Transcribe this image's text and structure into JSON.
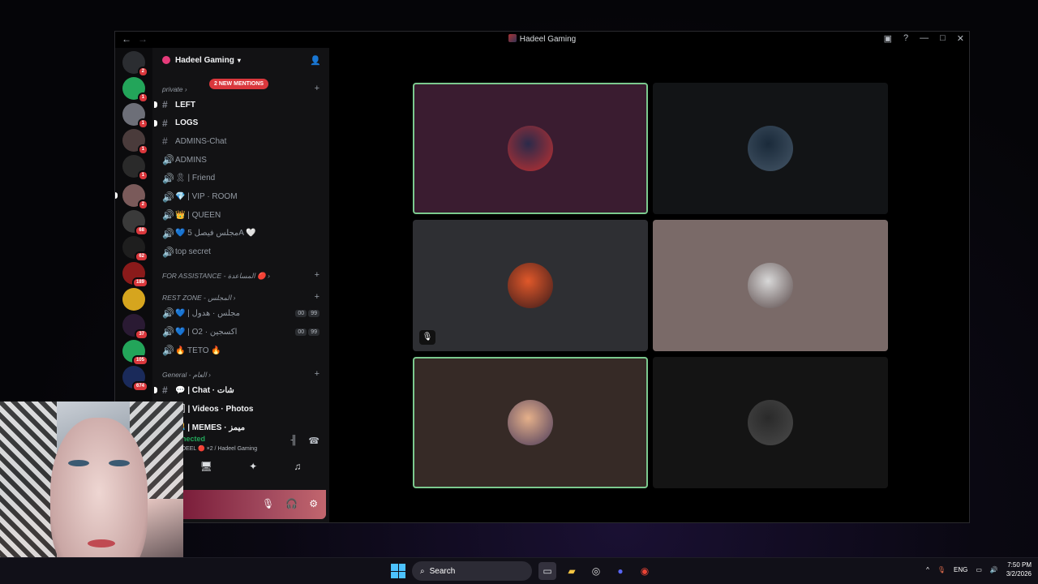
{
  "window": {
    "title": "Hadeel Gaming",
    "back_icon": "arrow-left-icon",
    "forward_icon": "arrow-right-icon"
  },
  "server_rail": {
    "items": [
      {
        "name": "direct-messages",
        "badge": "2",
        "color": "#2b2d31"
      },
      {
        "name": "server-1",
        "badge": "1",
        "color": "#23a55a"
      },
      {
        "name": "server-2",
        "badge": "1",
        "color": "#6d6f78"
      },
      {
        "name": "server-3",
        "badge": "1",
        "color": "#4a3b3b"
      },
      {
        "name": "server-4",
        "badge": "1",
        "color": "#2a2a2a"
      },
      {
        "name": "server-hadeel",
        "badge": "2",
        "color": "#7a5a5a"
      },
      {
        "name": "server-6",
        "badge": "68",
        "color": "#3a3a3a"
      },
      {
        "name": "server-7",
        "badge": "62",
        "color": "#1e1e1e"
      },
      {
        "name": "server-8",
        "badge": "189",
        "color": "#8a1a1a"
      },
      {
        "name": "server-emperor",
        "badge": "",
        "color": "#d6a51e"
      },
      {
        "name": "server-10",
        "badge": "37",
        "color": "#2a1a33"
      },
      {
        "name": "server-11",
        "badge": "105",
        "color": "#23a55a"
      },
      {
        "name": "server-12",
        "badge": "674",
        "color": "#1a2a5a"
      }
    ]
  },
  "channel_sidebar": {
    "server_name": "Hadeel Gaming",
    "mentions_badge": "2 NEW MENTIONS",
    "categories": [
      {
        "label": "private",
        "top": 0
      },
      {
        "label": "FOR ASSISTANCE - المساعدة",
        "top": 0
      },
      {
        "label": "REST ZONE - المجلس",
        "top": 0
      },
      {
        "label": "General - العام",
        "top": 0
      }
    ],
    "channels_private": [
      {
        "label": "LEFT",
        "type": "text",
        "bright": true
      },
      {
        "label": "LOGS",
        "type": "text",
        "bright": true
      },
      {
        "label": "ADMINS-Chat",
        "type": "text",
        "bright": false
      },
      {
        "label": "ADMINS",
        "type": "voice",
        "bright": false
      },
      {
        "label": "🎗 | Friend",
        "type": "voice",
        "bright": false
      },
      {
        "label": "💎 | VIP · ROOM",
        "type": "voice",
        "bright": false
      },
      {
        "label": "👑 | QUEEN",
        "type": "voice",
        "bright": false
      },
      {
        "label": "💙 مجلس فيصل 5A 🤍",
        "type": "voice",
        "bright": false
      },
      {
        "label": "top secret",
        "type": "voice",
        "bright": false
      }
    ],
    "channels_rest": [
      {
        "label": "💙 | مجلس · هدول",
        "meta": [
          "00",
          "99"
        ]
      },
      {
        "label": "💙 | O2 · اكسجين",
        "meta": [
          "00",
          "99"
        ]
      },
      {
        "label": "🔥 TETO 🔥",
        "meta": []
      }
    ],
    "channels_general": [
      {
        "label": "💬 | Chat · شات",
        "bright": true
      },
      {
        "label": "🖼 | Videos · Photos",
        "bright": true
      },
      {
        "label": "😹 | MEMES · ميمز",
        "bright": true
      }
    ]
  },
  "voice_panel": {
    "status": "Voice Connected",
    "status_visible": "nected",
    "subtext": "DEEL 🔴 ×2 / Hadeel Gaming"
  },
  "stage": {
    "tiles": [
      {
        "name": "tile-participant-1",
        "bg": "#3a1c30",
        "speaking": true,
        "avatar": [
          "#2a2a4a",
          "#c23030"
        ]
      },
      {
        "name": "tile-participant-2",
        "bg": "#121416",
        "speaking": false,
        "avatar": [
          "#1a2a3a",
          "#445566"
        ]
      },
      {
        "name": "tile-participant-3",
        "bg": "#2e2f33",
        "speaking": false,
        "avatar": [
          "#e0582a",
          "#3a1a1a"
        ],
        "muted": true
      },
      {
        "name": "tile-participant-4",
        "bg": "#7a6a68",
        "speaking": false,
        "avatar": [
          "#d8d8d8",
          "#5a4a4a"
        ]
      },
      {
        "name": "tile-participant-5",
        "bg": "#362a26",
        "speaking": true,
        "avatar": [
          "#e5b08a",
          "#4a3a5a"
        ]
      },
      {
        "name": "tile-participant-6",
        "bg": "#141414",
        "speaking": false,
        "avatar": [
          "#2a2a2a",
          "#4a4a4a"
        ]
      }
    ]
  },
  "taskbar": {
    "search_label": "Search",
    "language": "ENG",
    "time": "7:50 PM",
    "date": "3/2/2026"
  }
}
